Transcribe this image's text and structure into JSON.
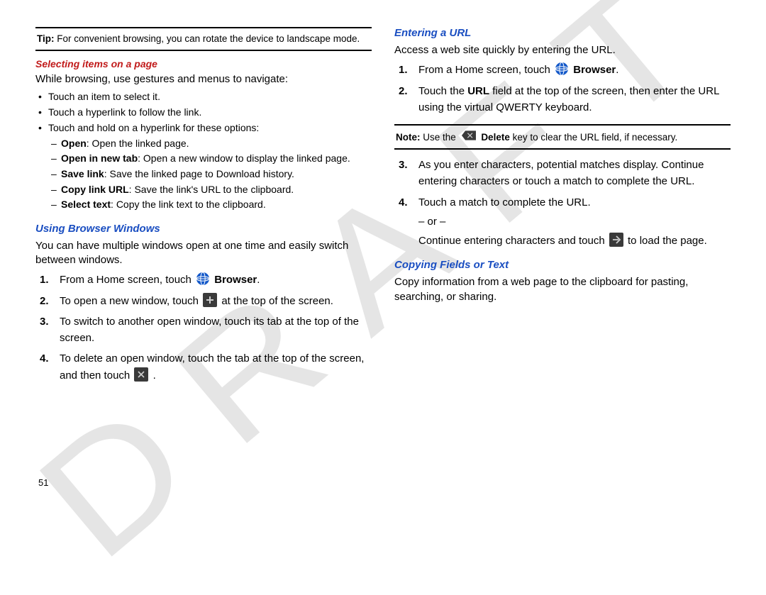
{
  "watermark": "DRAFT",
  "page_number": "51",
  "left": {
    "tip": {
      "label": "Tip:",
      "text": "For convenient browsing, you can rotate the device to landscape mode."
    },
    "sec1": {
      "heading": "Selecting items on a page",
      "intro": "While browsing, use gestures and menus to navigate:",
      "bullets": [
        "Touch an item to select it.",
        "Touch a hyperlink to follow the link.",
        "Touch and hold on a hyperlink for these options:"
      ],
      "dashes": [
        {
          "bold": "Open",
          "rest": ": Open the linked page."
        },
        {
          "bold": "Open in new tab",
          "rest": ": Open a new window to display the linked page."
        },
        {
          "bold": "Save link",
          "rest": ": Save the linked page to Download history."
        },
        {
          "bold": "Copy link URL",
          "rest": ": Save the link's URL to the clipboard."
        },
        {
          "bold": "Select text",
          "rest": ": Copy the link text to the clipboard."
        }
      ]
    },
    "sec2": {
      "heading": "Using Browser Windows",
      "intro": "You can have multiple windows open at one time and easily switch between windows.",
      "steps": {
        "s1": {
          "num": "1.",
          "pre": "From a Home screen, touch ",
          "post_bold": "Browser",
          "post": "."
        },
        "s2": {
          "num": "2.",
          "pre": "To open a new window, touch ",
          "post": " at the top of the screen."
        },
        "s3": {
          "num": "3.",
          "text": "To switch to another open window, touch its tab at the top of the screen."
        },
        "s4": {
          "num": "4.",
          "pre": "To delete an open window, touch the tab at the top of the screen, and then touch ",
          "post": "."
        }
      }
    }
  },
  "right": {
    "sec1": {
      "heading": "Entering a URL",
      "intro": "Access a web site quickly by entering the URL.",
      "steps": {
        "s1": {
          "num": "1.",
          "pre": "From a Home screen, touch ",
          "post_bold": "Browser",
          "post": "."
        },
        "s2": {
          "num": "2.",
          "pre": "Touch the ",
          "mid_bold": "URL",
          "post": " field at the top of the screen, then enter the URL using the virtual QWERTY keyboard."
        }
      },
      "note": {
        "label": "Note:",
        "pre": "Use the ",
        "mid_bold": "Delete",
        "post": " key to clear the URL field, if necessary."
      },
      "steps2": {
        "s3": {
          "num": "3.",
          "text": "As you enter characters, potential matches display. Continue entering characters or touch a match to complete the URL."
        },
        "s4": {
          "num": "4.",
          "l1": "Touch a match to complete the URL.",
          "or": "– or –",
          "l2pre": "Continue entering characters and touch ",
          "l2post": " to load the page."
        }
      }
    },
    "sec2": {
      "heading": "Copying Fields or Text",
      "intro": "Copy information from a web page to the clipboard for pasting, searching, or sharing."
    }
  }
}
